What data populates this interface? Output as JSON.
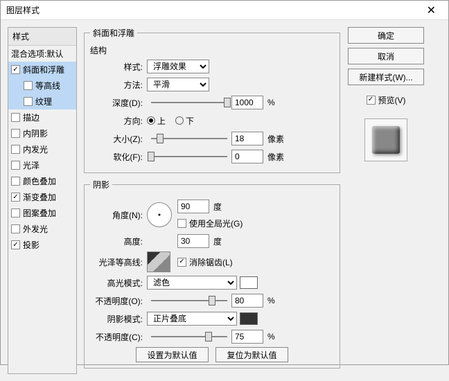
{
  "window": {
    "title": "图层样式"
  },
  "styles": {
    "header": "样式",
    "blend_defaults": "混合选项:默认",
    "items": [
      {
        "label": "斜面和浮雕",
        "checked": true,
        "selected": true
      },
      {
        "label": "等高线",
        "checked": false,
        "sub": true,
        "selected": true
      },
      {
        "label": "纹理",
        "checked": false,
        "sub": true,
        "selected": true
      },
      {
        "label": "描边",
        "checked": false
      },
      {
        "label": "内阴影",
        "checked": false
      },
      {
        "label": "内发光",
        "checked": false
      },
      {
        "label": "光泽",
        "checked": false
      },
      {
        "label": "颜色叠加",
        "checked": false
      },
      {
        "label": "渐变叠加",
        "checked": true
      },
      {
        "label": "图案叠加",
        "checked": false
      },
      {
        "label": "外发光",
        "checked": false
      },
      {
        "label": "投影",
        "checked": true
      }
    ]
  },
  "bevel": {
    "group": "斜面和浮雕",
    "structure": "结构",
    "style_label": "样式:",
    "style_value": "浮雕效果",
    "method_label": "方法:",
    "method_value": "平滑",
    "depth_label": "深度(D):",
    "depth_value": "1000",
    "depth_unit": "%",
    "direction_label": "方向:",
    "dir_up": "上",
    "dir_down": "下",
    "size_label": "大小(Z):",
    "size_value": "18",
    "size_unit": "像素",
    "soften_label": "软化(F):",
    "soften_value": "0",
    "soften_unit": "像素"
  },
  "shade": {
    "group": "阴影",
    "angle_label": "角度(N):",
    "angle_value": "90",
    "angle_unit": "度",
    "global_label": "使用全局光(G)",
    "altitude_label": "高度:",
    "altitude_value": "30",
    "altitude_unit": "度",
    "contour_label": "光泽等高线:",
    "antialias_label": "消除锯齿(L)",
    "highlight_mode_label": "高光模式:",
    "highlight_mode_value": "滤色",
    "opacity1_label": "不透明度(O):",
    "opacity1_value": "80",
    "opacity1_unit": "%",
    "shadow_mode_label": "阴影模式:",
    "shadow_mode_value": "正片叠底",
    "opacity2_label": "不透明度(C):",
    "opacity2_value": "75",
    "opacity2_unit": "%"
  },
  "buttons": {
    "ok": "确定",
    "cancel": "取消",
    "new_style": "新建样式(W)...",
    "preview": "预览(V)",
    "set_default": "设置为默认值",
    "reset_default": "复位为默认值"
  }
}
